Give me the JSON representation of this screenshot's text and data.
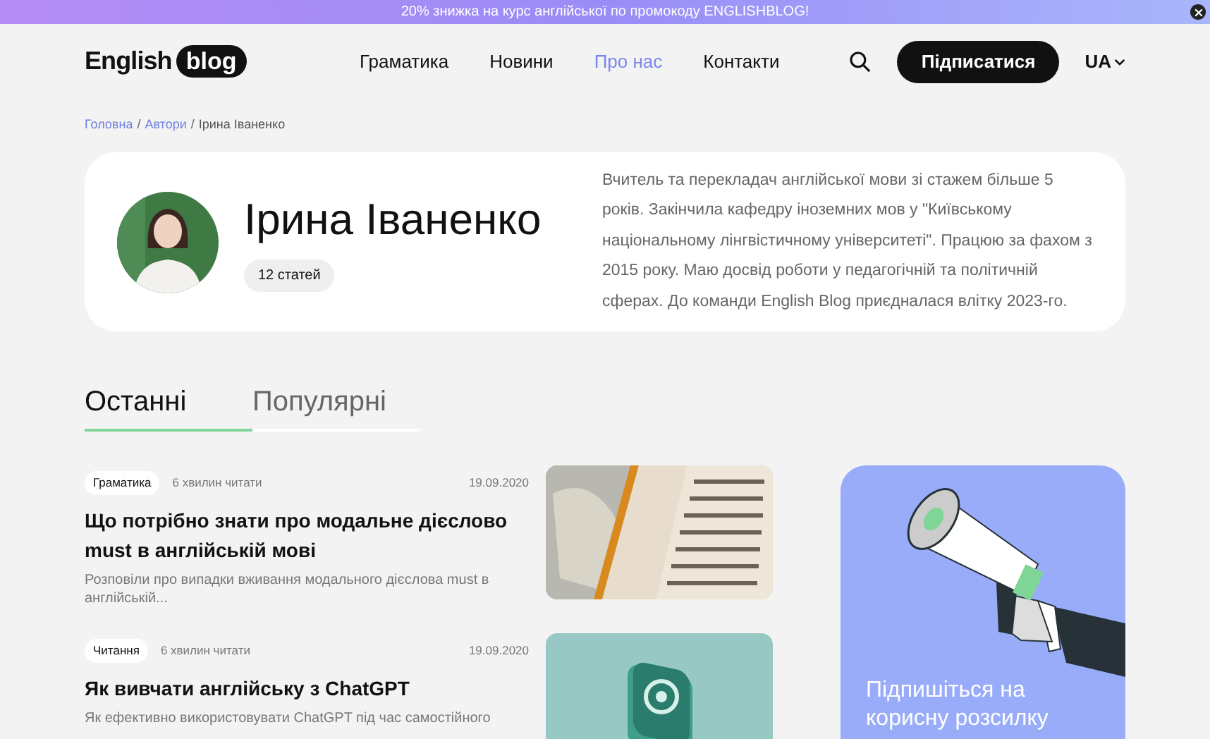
{
  "promo_banner": {
    "text": "20% знижка на курс англійської по промокоду ENGLISHBLOG!"
  },
  "header": {
    "logo": {
      "first": "English",
      "second": "blog"
    },
    "nav": [
      {
        "label": "Граматика",
        "selected": false
      },
      {
        "label": "Новини",
        "selected": false
      },
      {
        "label": "Про нас",
        "selected": true
      },
      {
        "label": "Контакти",
        "selected": false
      }
    ],
    "subscribe_button": "Підписатися",
    "language": "UA"
  },
  "breadcrumb_separator": "/",
  "breadcrumb": [
    {
      "label": "Головна",
      "kind": "link"
    },
    {
      "label": "Автори",
      "kind": "link"
    },
    {
      "label": "Ірина Іваненко",
      "kind": "current"
    }
  ],
  "author": {
    "name": "Ірина Іваненко",
    "articles_count": "12 статей",
    "bio": "Вчитель та перекладач англійської мови зі стажем більше 5 років. Закінчила кафедру іноземних мов у \"Київському національному лінгвістичному університеті\". Працюю за фахом з 2015 року. Маю досвід роботи у педагогічній та політичній сферах. До команди English Blog приєдналася влітку 2023-го."
  },
  "tabs": [
    {
      "label": "Останні",
      "selected": true
    },
    {
      "label": "Популярні",
      "selected": false
    }
  ],
  "articles": [
    {
      "category": "Граматика",
      "read_time": "6 хвилин читати",
      "date": "19.09.2020",
      "title": "Що потрібно знати про модальне дієслово must в англійській мові",
      "excerpt": "Розповіли про випадки вживання модального дієслова must в англійській..."
    },
    {
      "category": "Читання",
      "read_time": "6 хвилин читати",
      "date": "19.09.2020",
      "title": "Як вивчати англійську з ChatGPT",
      "excerpt": "Як ефективно використовувати ChatGPT під час самостійного"
    }
  ],
  "newsletter": {
    "title": "Підпишіться на корисну розсилку"
  }
}
